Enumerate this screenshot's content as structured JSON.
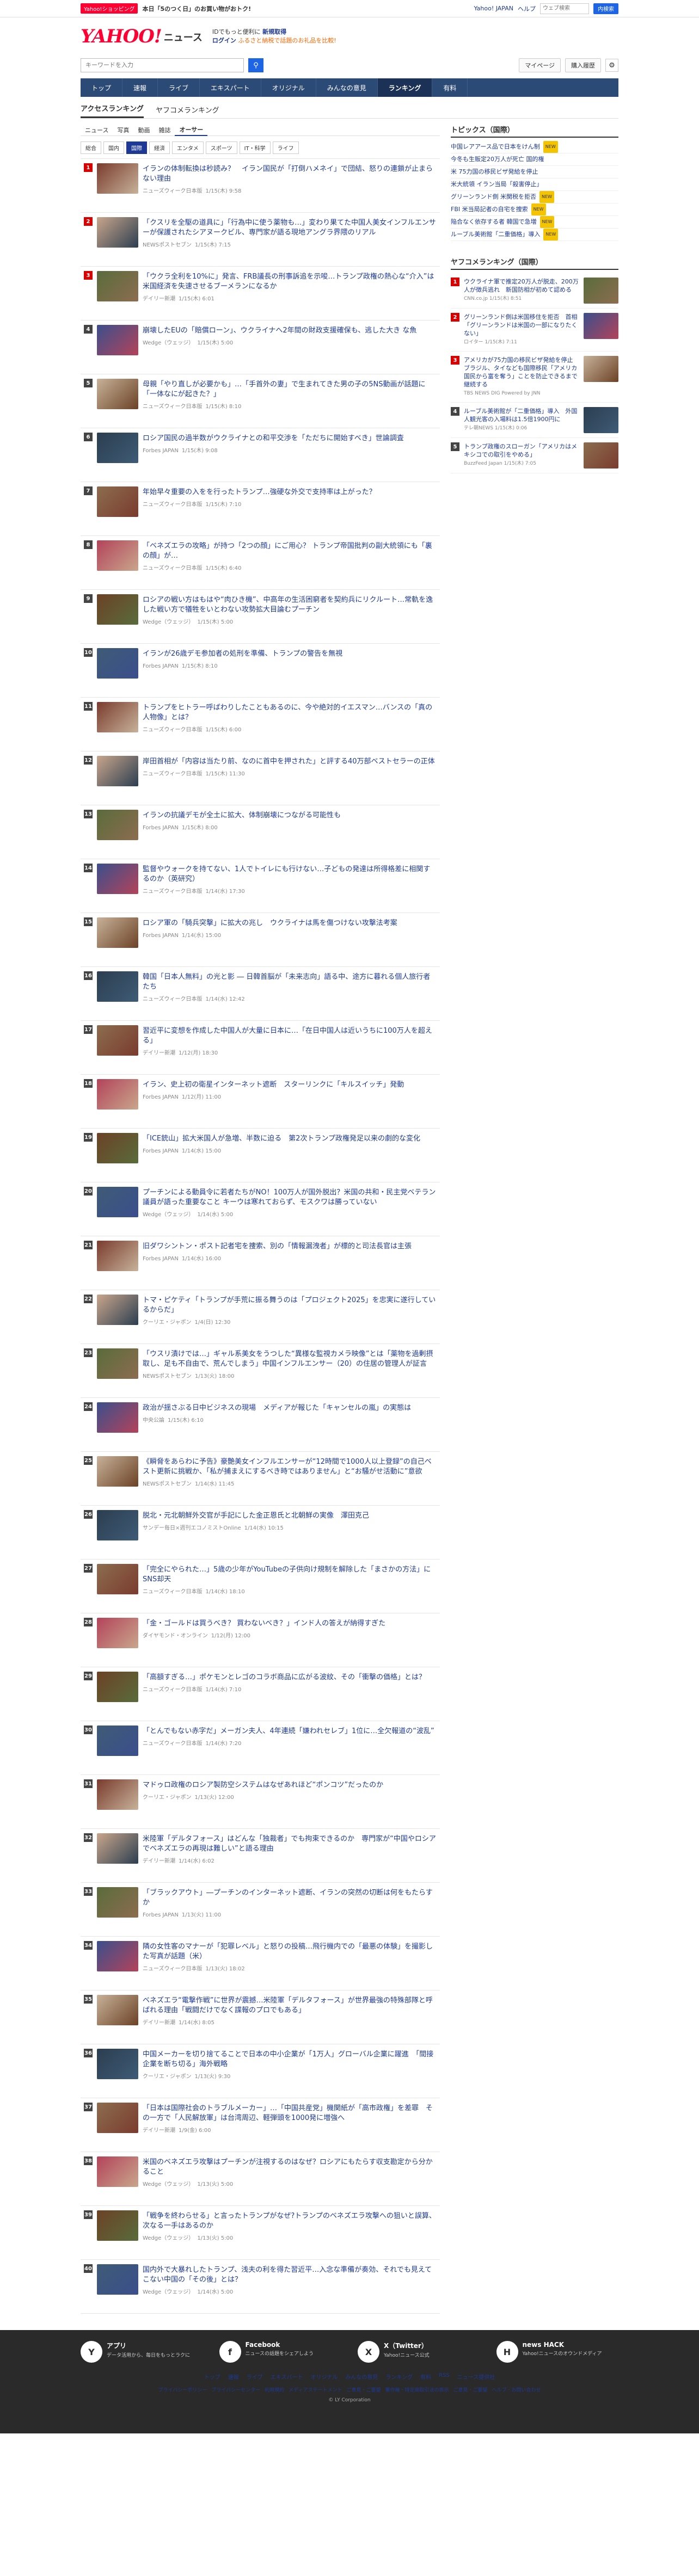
{
  "topbar": {
    "promo_badge": "Yahoo!ショッピング",
    "promo_text": "本日「5のつく日」のお買い物がおトク!",
    "links": [
      "Yahoo! JAPAN",
      "ヘルプ"
    ],
    "search_placeholder": "ウェブ検索",
    "search_button": "内検索",
    "accent": "#ff0033"
  },
  "header": {
    "logo_main": "YAHOO!",
    "logo_sub": "ニュース",
    "logo_japan": "JAPAN",
    "login_text_1": "IDでもっと便利に",
    "login_bold_1": "新規取得",
    "login_text_2": "ログイン",
    "login_note": "ふるさと納税で話題のお礼品を比較!"
  },
  "search": {
    "placeholder": "キーワードを入力",
    "mypage": "マイページ",
    "subscribe": "購入履歴"
  },
  "globalnav": [
    "トップ",
    "速報",
    "ライブ",
    "エキスパート",
    "オリジナル",
    "みんなの意見",
    "ランキング",
    "有料"
  ],
  "globalnav_active": 6,
  "subtabs": [
    "アクセスランキング",
    "ヤフコメランキング"
  ],
  "cattabs": [
    "ニュース",
    "写真",
    "動画",
    "雑誌",
    "オーサー"
  ],
  "subcats": [
    "総合",
    "国内",
    "国際",
    "経済",
    "エンタメ",
    "スポーツ",
    "IT・科学",
    "ライフ"
  ],
  "rankings": [
    {
      "n": "1",
      "title": "イランの体制転換は秒読み？　イラン国民が「打倒ハメネイ」で団結、怒りの連鎖が止まらない理由",
      "src": "ニューズウィーク日本版",
      "time": "1/15(木) 9:58"
    },
    {
      "n": "2",
      "title": "「クスリを全駆の道具に」「行為中に使う薬物も…」変わり果てた中国人美女インフルエンサーが保護されたシアヌークビル、専門家が語る現地アングラ界隈のリアル",
      "src": "NEWSポストセブン",
      "time": "1/15(木) 7:15"
    },
    {
      "n": "3",
      "title": "「ウクラ全利を10%に」発言、FRB議長の刑事訴追を示唆…トランプ政権の熱心な“介入”は米国経済を失速させるブーメランになるか",
      "src": "デイリー新潮",
      "time": "1/15(木) 6:01"
    },
    {
      "n": "4",
      "title": "崩壊したEUの「賠償ローン」、ウクライナへ2年間の財政支援確保も、逃した大き な魚",
      "src": "Wedge（ウェッジ）",
      "time": "1/15(木) 5:00"
    },
    {
      "n": "5",
      "title": "母親「やり直しが必要かも」…「手首外の妻」で生まれてきた男の子の5NS動画が話題に「一体なにが起きた？」",
      "src": "ニューズウィーク日本版",
      "time": "1/15(木) 8:10"
    },
    {
      "n": "6",
      "title": "ロシア国民の過半数がウクライナとの和平交渉を「ただちに開始すべき」世論調査",
      "src": "Forbes JAPAN",
      "time": "1/15(木) 9:08"
    },
    {
      "n": "7",
      "title": "年始早々重要の入をを行ったトランプ…強硬な外交で支持率は上がった？",
      "src": "ニューズウィーク日本版",
      "time": "1/15(木) 7:10"
    },
    {
      "n": "8",
      "title": "「ベネズエラの攻略」が持つ「2つの顔」にご用心？ トランプ帝国批判の副大統領にも「裏の顔」が…",
      "src": "ニューズウィーク日本版",
      "time": "1/15(木) 6:40"
    },
    {
      "n": "9",
      "title": "ロシアの戦い方はもはや“肉ひき機”、中高年の生活困窮者を契約兵にリクルート…常軌を逸した戦い方で犠牲をいとわない攻勢拡大目論むプーチン",
      "src": "Wedge（ウェッジ）",
      "time": "1/15(木) 5:00"
    },
    {
      "n": "10",
      "title": "イランが26歳デモ参加者の処刑を準備、トランプの警告を無視",
      "src": "Forbes JAPAN",
      "time": "1/15(木) 8:10"
    },
    {
      "n": "11",
      "title": "トランプをヒトラー呼ばわりしたこともあるのに、今や絶対的イエスマン…バンスの「真の人物像」とは？",
      "src": "ニューズウィーク日本版",
      "time": "1/15(木) 6:00"
    },
    {
      "n": "12",
      "title": "岸田首相が「内容は当たり前、なのに首中を押された」と評する40万部ベストセラーの正体",
      "src": "ニューズウィーク日本版",
      "time": "1/15(木) 11:30"
    },
    {
      "n": "13",
      "title": "イランの抗議デモが全土に拡大、体制崩壊につながる可能性も",
      "src": "Forbes JAPAN",
      "time": "1/15(木) 8:00"
    },
    {
      "n": "14",
      "title": "監督やウォークを持てない、1人でトイレにも行けない…子どもの発達は所得格差に相関するのか（英研究）",
      "src": "ニューズウィーク日本版",
      "time": "1/14(水) 17:30"
    },
    {
      "n": "15",
      "title": "ロシア軍の「騎兵突撃」に拡大の兆し　ウクライナは馬を傷つけない攻撃法考案",
      "src": "Forbes JAPAN",
      "time": "1/14(水) 15:00"
    },
    {
      "n": "16",
      "title": "韓国「日本人無料」の光と影 ― 日韓首脳が「未来志向」語る中、途方に暮れる個人旅行者たち",
      "src": "ニューズウィーク日本版",
      "time": "1/14(水) 12:42"
    },
    {
      "n": "17",
      "title": "習近平に変想を作成した中国人が大量に日本に…「在日中国人は近いうちに100万人を超える」",
      "src": "デイリー新潮",
      "time": "1/12(月) 18:30"
    },
    {
      "n": "18",
      "title": "イラン、史上初の衛星インターネット遮断　スターリンクに「キルスイッチ」発動",
      "src": "Forbes JAPAN",
      "time": "1/12(月) 11:00"
    },
    {
      "n": "19",
      "title": "「ICE銃山」拡大米国人が急増、半数に迫る　第2次トランプ政権発足以来の劇的な変化",
      "src": "Forbes JAPAN",
      "time": "1/14(水) 15:00"
    },
    {
      "n": "20",
      "title": "プーチンによる動員令に若者たちがNO！100万人が国外脱出？米国の共和・民主党ベテラン議員が語った重要なこと キーウは寒れておらず、モスクワは勝っていない",
      "src": "Wedge（ウェッジ）",
      "time": "1/14(水) 5:00"
    },
    {
      "n": "21",
      "title": "旧ダワシントン・ポスト記者宅を捜索、別の「情報漏洩者」が標的と司法長官は主張",
      "src": "Forbes JAPAN",
      "time": "1/14(水) 16:00"
    },
    {
      "n": "22",
      "title": "トマ・ピケティ「トランプが手荒に振る舞うのは「プロジェクト2025」を忠実に遂行しているからだ」",
      "src": "クーリエ・ジャポン",
      "time": "1/4(日) 12:30"
    },
    {
      "n": "23",
      "title": "「ウスリ漬けでは…」ギャル系美女をうつした“異様な監視カメラ映像”とは「薬物を過剰摂取し、足も不自由で、荒んでしまう」中国インフルエンサー（20）の住居の管理人が証言",
      "src": "NEWSポストセブン",
      "time": "1/13(火) 18:00"
    },
    {
      "n": "24",
      "title": "政治が揺さぶる日中ビジネスの現場　メディアが報じた「キャンセルの嵐」の実態は",
      "src": "中央公論",
      "time": "1/15(木) 6:10"
    },
    {
      "n": "25",
      "title": "《瞬脅をあらわに予告》豪艶美女インフルエンサーが“12時間で1000人以上登録”の自己ベスト更新に挑戦か、「私が捕まえにするべき時ではありません」と“お騒がせ活動に”意欲",
      "src": "NEWSポストセブン",
      "time": "1/14(水) 11:45"
    },
    {
      "n": "26",
      "title": "脱北・元北朝鮮外交官が手記にした金正恩氏と北朝鮮の実像　澤田克己",
      "src": "サンデー毎日×週刊エコノミストOnline",
      "time": "1/14(水) 10:15"
    },
    {
      "n": "27",
      "title": "「完全にやられた…」5歳の少年がYouTubeの子供向け規制を解除した「まさかの方法」にSNS却天",
      "src": "ニューズウィーク日本版",
      "time": "1/14(水) 18:10"
    },
    {
      "n": "28",
      "title": "「金・ゴールドは買うべき？ 買わないべき？」インド人の答えが納得すぎた",
      "src": "ダイヤモンド・オンライン",
      "time": "1/12(月) 12:00"
    },
    {
      "n": "29",
      "title": "「高額すぎる…」ポケモンとレゴのコラボ商品に広がる波紋、その「衝撃の価格」とは？",
      "src": "ニューズウィーク日本版",
      "time": "1/14(水) 7:10"
    },
    {
      "n": "30",
      "title": "「とんでもない赤字だ」メーガン夫人、4年連続「嫌われセレブ」1位に…全欠報道の“波乱”",
      "src": "ニューズウィーク日本版",
      "time": "1/14(水) 7:20"
    },
    {
      "n": "31",
      "title": "マドゥロ政権のロシア製防空システムはなぜあれほど“ポンコツ”だったのか",
      "src": "クーリエ・ジャポン",
      "time": "1/13(火) 12:00"
    },
    {
      "n": "32",
      "title": "米陸軍「デルタフォース」はどんな「独裁者」でも拘束できるのか　専門家が“中国やロシアでベネズエラの再現は難しい”と語る理由",
      "src": "デイリー新潮",
      "time": "1/14(水) 6:02"
    },
    {
      "n": "33",
      "title": "「ブラックアウト」―プーチンのインターネット遮断、イランの突然の切断は何をもたらすか",
      "src": "Forbes JAPAN",
      "time": "1/13(火) 11:00"
    },
    {
      "n": "34",
      "title": "隣の女性客のマナーが「犯罪レベル」と怒りの投稿…飛行機内での「最悪の体験」を撮影した写真が話題（米）",
      "src": "ニューズウィーク日本版",
      "time": "1/13(火) 18:02"
    },
    {
      "n": "35",
      "title": "ベネズエラ“電撃作戦”に世界が震撼…米陸軍「デルタフォース」が世界最強の特殊部隊と呼ばれる理由「戦闘だけでなく諜報のプロでもある」",
      "src": "デイリー新潮",
      "time": "1/14(水) 8:05"
    },
    {
      "n": "36",
      "title": "中国メーカーを切り捨てることで日本の中小企業が「1万人」グローバル企業に躍進　「間接企業を断ち切る」海外戦略",
      "src": "クーリエ・ジャポン",
      "time": "1/13(火) 9:30"
    },
    {
      "n": "37",
      "title": "「日本は国際社会のトラブルメーカー」…「中国共産党」機関紙が「高市政権」を差罪　その一方で「人民解放軍」は台湾周辺、軽弾頭を1000発に増強へ",
      "src": "デイリー新潮",
      "time": "1/9(金) 6:00"
    },
    {
      "n": "38",
      "title": "米国のベネズエラ攻撃はプーチンが注視するのはなぜ？ロシアにもたらす収支勘定から分かること",
      "src": "Wedge（ウェッジ）",
      "time": "1/13(火) 5:00"
    },
    {
      "n": "39",
      "title": "「戦争を終わらせる」と言ったトランプがなぜ?トランプのベネズエラ攻撃への狙いと誤算、次なる一手はあるのか",
      "src": "Wedge（ウェッジ）",
      "time": "1/13(火) 5:00"
    },
    {
      "n": "40",
      "title": "国内外で大暴れしたトランプ、浅夫の利を得た習近平…入念な準備が奏効、それでも見えてこない中国の「その後」とは？",
      "src": "Wedge（ウェッジ）",
      "time": "1/14(水) 5:00"
    }
  ],
  "side_topics": {
    "heading": "トピックス（国際）",
    "items": [
      {
        "t": "中国レアアース品で日本をけん制",
        "new": "NEW"
      },
      {
        "t": "今冬も生販定20万人が死亡 国的権",
        "new": ""
      },
      {
        "t": "米 75力国の移民ビザ発給を停止",
        "new": ""
      },
      {
        "t": "米大統領 イラン当局「殺害停止」",
        "new": ""
      },
      {
        "t": "グリーンランド側 米関税を拒否",
        "new": "NEW"
      },
      {
        "t": "FBI 米当局記者の自宅を捜索",
        "new": "NEW"
      },
      {
        "t": "陥合なく依存する者 韓国で急増",
        "new": "NEW"
      },
      {
        "t": "ルーブル美術館「二重価格」導入",
        "new": "NEW"
      }
    ]
  },
  "side_ranking": {
    "heading": "ヤフコメランキング（国際）",
    "items": [
      {
        "n": "1",
        "t": "ウクライナ軍で推定20万人が脱走、200万人が徴兵逃れ　新国防相が初めて認める",
        "m": "CNN.co.jp 1/15(木) 8:51"
      },
      {
        "n": "2",
        "t": "グリーンランド側は米国移住を拒否　首相「グリーンランドは米国の一部になりたくない」",
        "m": "ロイター 1/15(木) 7:11"
      },
      {
        "n": "3",
        "t": "アメリカが75力国の移民ビザ発給を停止　ブラジル、タイなども国際移民「アメリカ国民から富を奪う」ことを防止できるまで継続する",
        "m": "TBS NEWS DIG Powered by JNN"
      },
      {
        "n": "4",
        "t": "ルーブル美術館が「二重価格」導入　外国人観光客の入場料は1.5倍1900円に",
        "m": "テレ朝NEWS 1/15(木) 0:06"
      },
      {
        "n": "5",
        "t": "トランプ政権のスローガン「アメリカはメキシコでの取引をやめる」",
        "m": "BuzzFeed Japan 1/15(木) 7:05"
      }
    ]
  },
  "footer": {
    "cols": [
      {
        "icon": "app-icon",
        "t": "アプリ",
        "d": "データ活用から、毎日をもっとラクに"
      },
      {
        "icon": "facebook-icon",
        "t": "Facebook",
        "d": "ニュースの話題をシェアしよう"
      },
      {
        "icon": "x-icon",
        "t": "X（Twitter）",
        "d": "Yahoo!ニュース公式"
      },
      {
        "icon": "newshack-icon",
        "t": "news HACK",
        "d": "Yahoo!ニュースのオウンドメディア"
      }
    ],
    "links": [
      "トップ",
      "速報",
      "ライブ",
      "エキスパート",
      "オリジナル",
      "みんなの意見",
      "ランキング",
      "有料",
      "RSS",
      "ニュース提供社"
    ],
    "bottom": [
      "プライバシーポリシー",
      "プライバシーセンター",
      "利用規約",
      "メディアステートメント",
      "ご意見・ご要望",
      "著作権・特定商取引法の表示",
      "ご意見・ご要望",
      "ヘルプ・お問い合わせ"
    ],
    "copyright": "© LY Corporation"
  }
}
